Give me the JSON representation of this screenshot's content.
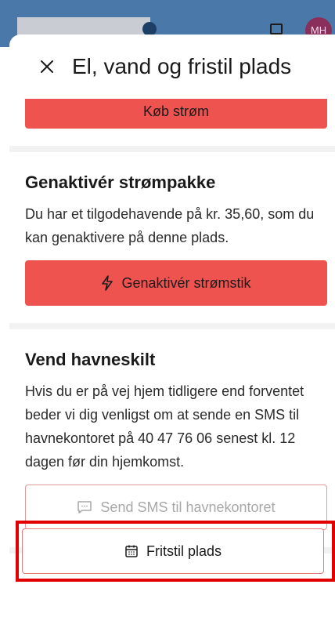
{
  "background": {
    "avatar_initials": "MH",
    "header_color": "#4a78a8"
  },
  "sheet": {
    "title": "El, vand og fristil plads",
    "close_icon": "close-icon"
  },
  "buy_power": {
    "label": "Køb strøm"
  },
  "reactivate": {
    "title": "Genaktivér strømpakke",
    "text": "Du har et tilgodehavende på kr. 35,60, som du kan genaktivere på denne plads.",
    "button_label": "Genaktivér strømstik",
    "button_icon": "lightning-icon"
  },
  "harbor_sign": {
    "title": "Vend havneskilt",
    "text": "Hvis du er på vej hjem tidligere end forventet beder vi dig venligst om at sende en SMS til havnekontoret på 40 47 76 06 senest kl. 12 dagen før din hjemkomst.",
    "button_label": "Send SMS til havnekontoret",
    "button_icon": "message-icon"
  },
  "release_spot": {
    "button_label": "Fritstil plads",
    "button_icon": "calendar-icon"
  },
  "colors": {
    "accent_red": "#ef5350",
    "highlight": "#e00000"
  }
}
